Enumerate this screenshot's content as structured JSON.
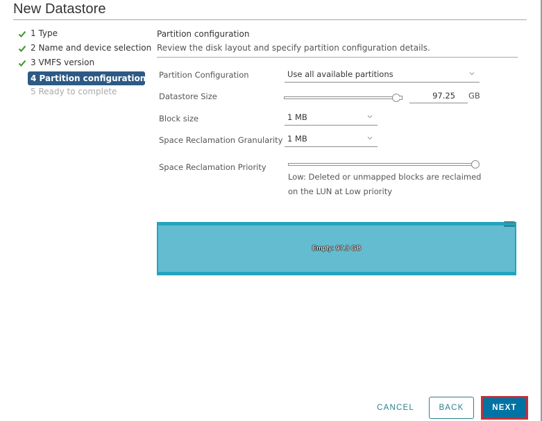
{
  "window": {
    "title": "New Datastore"
  },
  "steps": [
    {
      "label": "1 Type",
      "state": "completed",
      "icon": "check-icon"
    },
    {
      "label": "2 Name and device selection",
      "state": "completed",
      "icon": "check-icon"
    },
    {
      "label": "3 VMFS version",
      "state": "completed",
      "icon": "check-icon"
    },
    {
      "label": "4 Partition configuration",
      "state": "active"
    },
    {
      "label": "5 Ready to complete",
      "state": "disabled"
    }
  ],
  "section": {
    "title": "Partition configuration",
    "description": "Review the disk layout and specify partition configuration details."
  },
  "form": {
    "partition_configuration": {
      "label": "Partition Configuration",
      "value": "Use all available partitions"
    },
    "datastore_size": {
      "label": "Datastore Size",
      "value": "97.25",
      "unit": "GB",
      "slider_fraction": 1.0
    },
    "block_size": {
      "label": "Block size",
      "value": "1 MB"
    },
    "space_reclamation_granularity": {
      "label": "Space Reclamation Granularity",
      "value": "1 MB"
    },
    "space_reclamation_priority": {
      "label": "Space Reclamation Priority",
      "slider_fraction": 1.0,
      "description": "Low: Deleted or unmapped blocks are reclaimed on the LUN at Low priority"
    }
  },
  "disk_layout": {
    "segment_label": "Empty: 97.3 GB",
    "colors": {
      "fill": "#63bccf",
      "border": "#22a4bd"
    }
  },
  "footer": {
    "cancel_label": "CANCEL",
    "back_label": "BACK",
    "next_label": "NEXT"
  },
  "colors": {
    "accent": "#0072a3",
    "active_step": "#2d5a85",
    "check": "#4a9a3a",
    "highlight_border": "#c0313a"
  }
}
